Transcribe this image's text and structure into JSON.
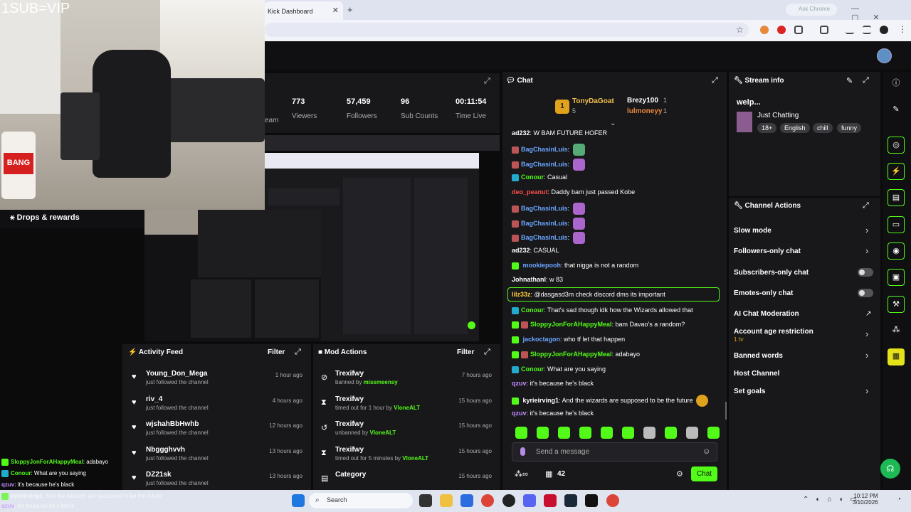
{
  "browser": {
    "tab_title": "Kick Dashboard",
    "ask_label": "Ask Chrome"
  },
  "webcam": {
    "overlay_text": "1SUB=VIP",
    "product_label": "BANG"
  },
  "drops": {
    "label": "Drops & rewards"
  },
  "stats": [
    {
      "value": "773",
      "label": "Viewers"
    },
    {
      "value": "57,459",
      "label": "Followers"
    },
    {
      "value": "96",
      "label": "Sub Counts"
    },
    {
      "value": "00:11:54",
      "label": "Time Live"
    }
  ],
  "stats_partial_label": "eam",
  "activity_feed": {
    "title": "Activity Feed",
    "filter": "Filter",
    "items": [
      {
        "name": "Young_Don_Mega",
        "sub": "just followed the channel",
        "time": "1 hour ago"
      },
      {
        "name": "riv_4",
        "sub": "just followed the channel",
        "time": "4 hours ago"
      },
      {
        "name": "wjshahBbHwhb",
        "sub": "just followed the channel",
        "time": "12 hours ago"
      },
      {
        "name": "Nbggghvvh",
        "sub": "just followed the channel",
        "time": "13 hours ago"
      },
      {
        "name": "DZ21sk",
        "sub": "just followed the channel",
        "time": "13 hours ago"
      }
    ]
  },
  "mod_actions": {
    "title": "Mod Actions",
    "filter": "Filter",
    "items": [
      {
        "name": "Trexifwy",
        "action": "banned by",
        "by": "missmeensy",
        "time": "7 hours ago"
      },
      {
        "name": "Trexifwy",
        "action": "timed out for 1 hour by",
        "by": "VloneALT",
        "time": "15 hours ago"
      },
      {
        "name": "Trexifwy",
        "action": "unbanned by",
        "by": "VloneALT",
        "time": "15 hours ago"
      },
      {
        "name": "Trexifwy",
        "action": "timed out for 5 minutes by",
        "by": "VloneALT",
        "time": "15 hours ago"
      },
      {
        "name": "Category",
        "action": "",
        "by": "",
        "time": "15 hours ago"
      }
    ]
  },
  "chat": {
    "title": "Chat",
    "leaderboard": {
      "first": "TonyDaGoat",
      "first_count": "5",
      "second": "Brezy100",
      "second_count": "1",
      "third": "lulmoneyy",
      "third_count": "1",
      "rank": "1"
    },
    "messages": [
      {
        "user": "ad232",
        "text": "W BAM FUTURE HOFER",
        "color": "#ffffff"
      },
      {
        "user": "BagChasinLuis",
        "text": "",
        "color": "#6aa6ff"
      },
      {
        "user": "BagChasinLuis",
        "text": "",
        "color": "#6aa6ff"
      },
      {
        "user": "Conour",
        "text": "Casual",
        "color": "#53fc18"
      },
      {
        "user": "deo_peanut",
        "text": "Daddy bam just passed Kobe",
        "color": "#ff4d4d"
      },
      {
        "user": "BagChasinLuis",
        "text": "",
        "color": "#6aa6ff"
      },
      {
        "user": "BagChasinLuis",
        "text": "",
        "color": "#6aa6ff"
      },
      {
        "user": "BagChasinLuis",
        "text": "",
        "color": "#6aa6ff"
      },
      {
        "user": "ad232",
        "text": "CASUAL",
        "color": "#ffffff"
      },
      {
        "user": "mookiepooh",
        "text": "that nigga is not a random",
        "color": "#6aa6ff"
      },
      {
        "user": "Johnathanl",
        "text": "w 83",
        "color": "#ffffff"
      },
      {
        "user": "lilz33z",
        "text": "@dasgasd3m check discord dms its important",
        "color": "#ffcc33"
      },
      {
        "user": "Conour",
        "text": "That's sad though idk how the Wizards allowed that",
        "color": "#53fc18"
      },
      {
        "user": "SloppyJonForAHappyMeal",
        "text": "bam Davao's a random?",
        "color": "#53fc18"
      },
      {
        "user": "jackoctagon",
        "text": "who tf let that happen",
        "color": "#6aa6ff"
      },
      {
        "user": "SloppyJonForAHappyMeal",
        "text": "adabayo",
        "color": "#53fc18"
      },
      {
        "user": "Conour",
        "text": "What are you saying",
        "color": "#53fc18"
      },
      {
        "user": "qzuv",
        "text": "it's because he's black",
        "color": "#c58cff"
      },
      {
        "user": "kyrieirving1",
        "text": "And the wizards are supposed to be the future",
        "color": "#ffffff"
      },
      {
        "user": "qzuv",
        "text": "it's because he's black",
        "color": "#c58cff"
      }
    ],
    "input_placeholder": "Send a message",
    "viewer_count": "42",
    "send_label": "Chat"
  },
  "stream_info": {
    "title": "Stream info",
    "stream_title": "welp...",
    "category": "Just Chatting",
    "tags": [
      "18+",
      "English",
      "chill",
      "funny"
    ]
  },
  "channel_actions": {
    "title": "Channel Actions",
    "items": [
      {
        "label": "Slow mode",
        "sub": ""
      },
      {
        "label": "Followers-only chat",
        "sub": ""
      },
      {
        "label": "Subscribers-only chat",
        "sub": ""
      },
      {
        "label": "Emotes-only chat",
        "sub": ""
      },
      {
        "label": "AI Chat Moderation",
        "sub": ""
      },
      {
        "label": "Account age restriction",
        "sub": "1 hr"
      },
      {
        "label": "Banned words",
        "sub": ""
      },
      {
        "label": "Host Channel",
        "sub": ""
      },
      {
        "label": "Set goals",
        "sub": ""
      }
    ]
  },
  "left_overlay": [
    {
      "user": "SloppyJonForAHappyMeal",
      "text": ": adabayo",
      "color": "#53fc18"
    },
    {
      "user": "Conour",
      "text": ": What are you saying",
      "color": "#53fc18"
    },
    {
      "user": "qzuv",
      "text": ": it's because he's black",
      "color": "#c58cff"
    },
    {
      "user": "kyrieirving1",
      "text": ": And the wizards are supposed to be the future",
      "color": "#ffffff"
    },
    {
      "user": "qzuv",
      "text": ": it's because he's black",
      "color": "#c58cff"
    }
  ],
  "taskbar": {
    "search": "Search",
    "time": "10:12 PM",
    "date": "3/10/2026"
  },
  "colors": {
    "accent": "#53fc18",
    "panel": "#18181b",
    "bg": "#0b0b0c"
  }
}
